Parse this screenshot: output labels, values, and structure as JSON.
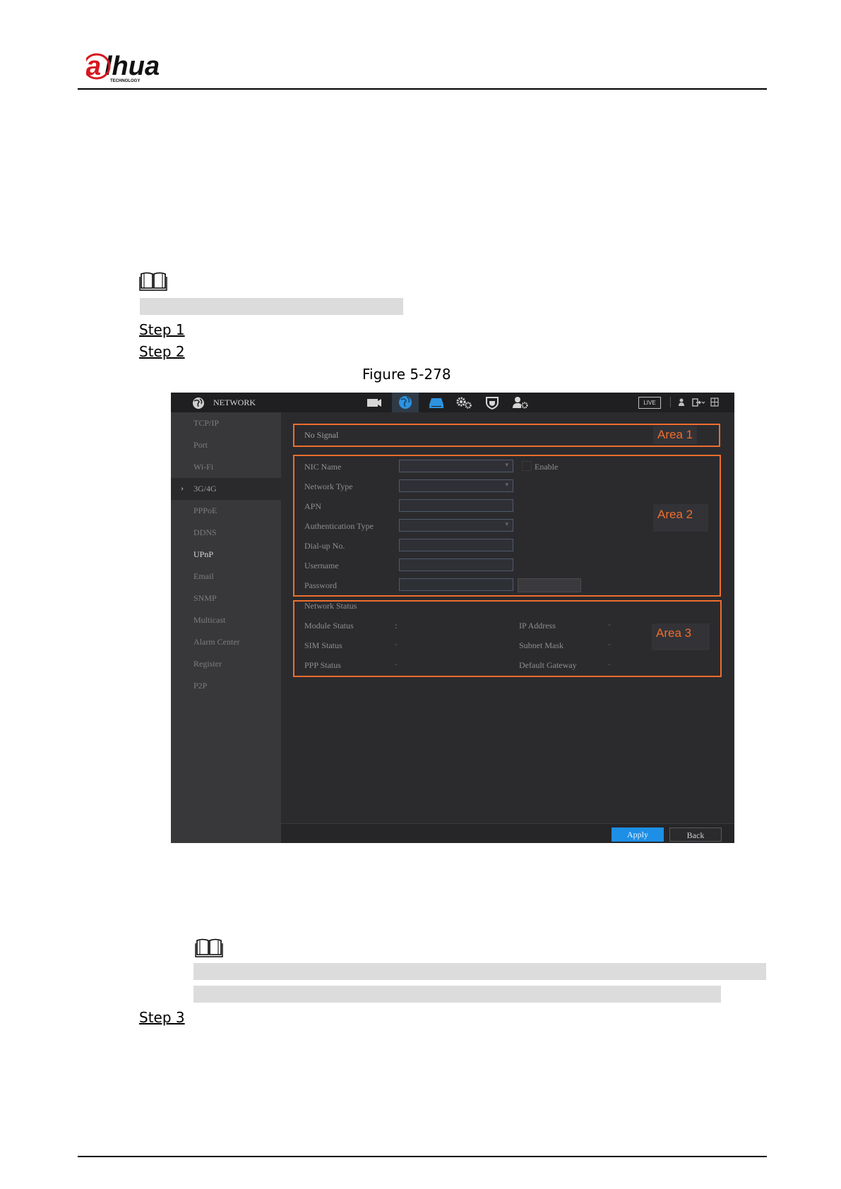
{
  "header": {
    "logo_text": "alhua",
    "logo_sub": "TECHNOLOGY"
  },
  "steps": {
    "step1": "Step 1",
    "step2": "Step 2",
    "step3": "Step 3"
  },
  "figure": {
    "caption": "Figure 5-278"
  },
  "ui": {
    "topbar": {
      "title": "NETWORK",
      "live_badge": "LIVE",
      "icons": [
        "globe-icon",
        "camera-icon",
        "network-icon",
        "storage-icon",
        "settings-icon",
        "shield-icon",
        "account-icon",
        "user-icon",
        "logout-icon",
        "grid-icon"
      ]
    },
    "sidebar": {
      "items": [
        {
          "label": "TCP/IP"
        },
        {
          "label": "Port"
        },
        {
          "label": "Wi-Fi"
        },
        {
          "label": "3G/4G"
        },
        {
          "label": "PPPoE"
        },
        {
          "label": "DDNS"
        },
        {
          "label": "UPnP"
        },
        {
          "label": "Email"
        },
        {
          "label": "SNMP"
        },
        {
          "label": "Multicast"
        },
        {
          "label": "Alarm Center"
        },
        {
          "label": "Register"
        },
        {
          "label": "P2P"
        }
      ]
    },
    "area1": {
      "signal": "No Signal",
      "tag": "Area 1"
    },
    "area2": {
      "tag": "Area 2",
      "nic_name": "NIC Name",
      "enable": "Enable",
      "network_type": "Network Type",
      "apn": "APN",
      "auth_type": "Authentication Type",
      "dialup": "Dial-up No.",
      "username": "Username",
      "password": "Password"
    },
    "area3": {
      "tag": "Area 3",
      "network_status": "Network Status",
      "module_status": "Module Status",
      "module_status_value": ":",
      "sim_status": "SIM Status",
      "sim_status_value": "-",
      "ppp_status": "PPP Status",
      "ppp_status_value": "-",
      "ip_address": "IP Address",
      "ip_address_value": "-",
      "subnet_mask": "Subnet Mask",
      "subnet_mask_value": "-",
      "default_gateway": "Default Gateway",
      "default_gateway_value": "-"
    },
    "footer": {
      "apply": "Apply",
      "back": "Back"
    }
  },
  "colors": {
    "accent_orange": "#ef6d2c",
    "apply_blue": "#1e8fe6",
    "screen_bg": "#2b2b2e"
  }
}
